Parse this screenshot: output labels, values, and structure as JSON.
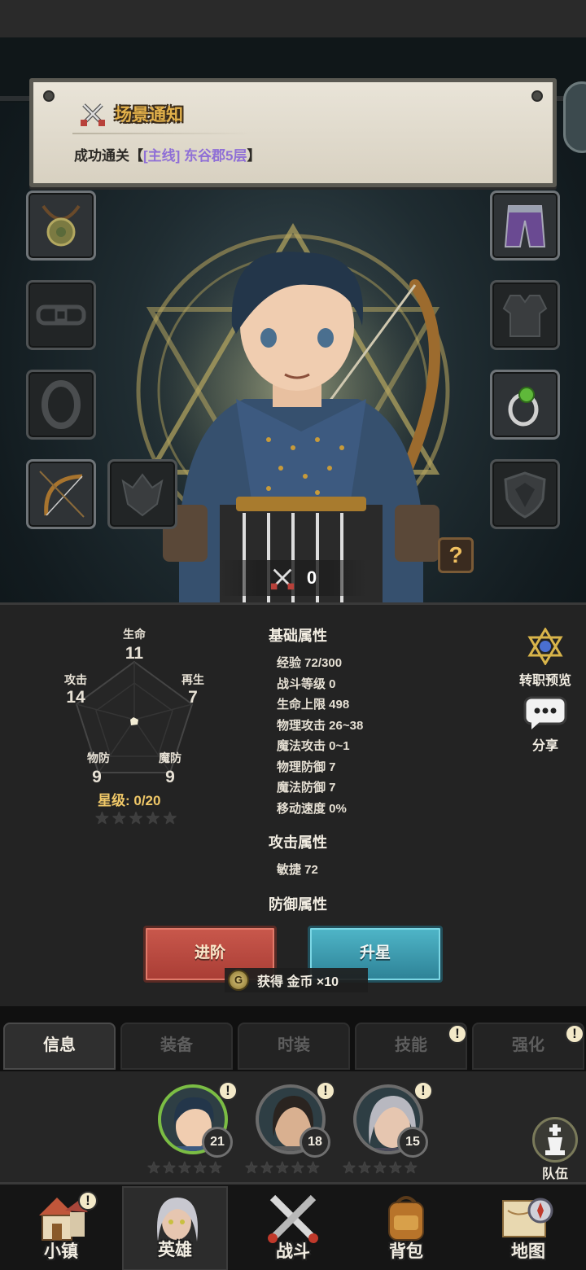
{
  "notice": {
    "title": "场景通知",
    "message_prefix": "成功通关【",
    "message_highlight": "[主线] 东谷郡5层",
    "message_suffix": "】"
  },
  "power": {
    "value": "0"
  },
  "help": {
    "label": "?"
  },
  "radar": {
    "hp": {
      "label": "生命",
      "value": "11"
    },
    "regen": {
      "label": "再生",
      "value": "7"
    },
    "mdef": {
      "label": "魔防",
      "value": "9"
    },
    "pdef": {
      "label": "物防",
      "value": "9"
    },
    "atk": {
      "label": "攻击",
      "value": "14"
    },
    "star_level": "星级: 0/20"
  },
  "attributes": {
    "basic_title": "基础属性",
    "basic": [
      "经验 72/300",
      "战斗等级 0",
      "生命上限 498",
      "物理攻击 26~38",
      "魔法攻击 0~1",
      "物理防御 7",
      "魔法防御 7",
      "移动速度 0%"
    ],
    "attack_title": "攻击属性",
    "attack": [
      "敏捷 72"
    ],
    "defense_title": "防御属性"
  },
  "side_buttons": {
    "job_preview": "转职预览",
    "share": "分享"
  },
  "actions": {
    "advance": "进阶",
    "star_up": "升星"
  },
  "toast": {
    "text": "获得 金币 ×10",
    "coin_glyph": "G"
  },
  "tabs": [
    "信息",
    "装备",
    "时装",
    "技能",
    "强化"
  ],
  "roster": {
    "heroes": [
      {
        "level": "21"
      },
      {
        "level": "18"
      },
      {
        "level": "15"
      }
    ],
    "team_label": "队伍"
  },
  "nav": [
    "小镇",
    "英雄",
    "战斗",
    "背包",
    "地图"
  ],
  "badge_glyph": "!"
}
